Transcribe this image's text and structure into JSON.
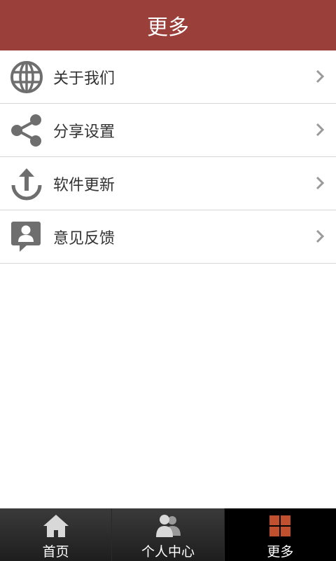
{
  "header": {
    "title": "更多"
  },
  "menu": {
    "items": [
      {
        "label": "关于我们",
        "icon": "globe-icon"
      },
      {
        "label": "分享设置",
        "icon": "share-icon"
      },
      {
        "label": "软件更新",
        "icon": "update-icon"
      },
      {
        "label": "意见反馈",
        "icon": "feedback-icon"
      }
    ]
  },
  "tabbar": {
    "tabs": [
      {
        "label": "首页",
        "icon": "home-icon"
      },
      {
        "label": "个人中心",
        "icon": "users-icon"
      },
      {
        "label": "更多",
        "icon": "grid-icon",
        "active": true
      }
    ]
  },
  "colors": {
    "header_bg": "#9a3f3a",
    "icon_gray": "#6e6e6e",
    "grid_icon": "#c0502e"
  }
}
